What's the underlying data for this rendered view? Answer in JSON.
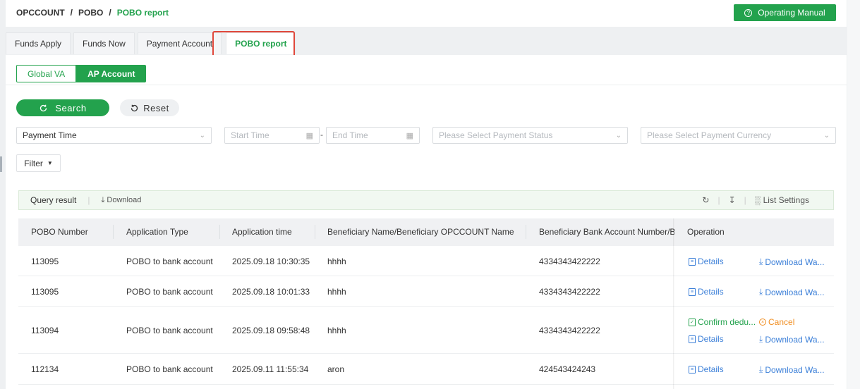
{
  "breadcrumb": {
    "root": "OPCCOUNT",
    "mid": "POBO",
    "current": "POBO report",
    "sep": "/"
  },
  "header": {
    "manual_label": "Operating Manual",
    "manual_icon": "question-circle-icon"
  },
  "tabs": [
    {
      "label": "Funds Apply"
    },
    {
      "label": "Funds Now"
    },
    {
      "label": "Payment Account"
    },
    {
      "label": "POBO report",
      "active": true
    }
  ],
  "segment": {
    "off_label": "Global VA",
    "on_label": "AP Account"
  },
  "actions": {
    "search_label": "Search",
    "reset_label": "Reset"
  },
  "filters": {
    "time_type_value": "Payment Time",
    "start_placeholder": "Start Time",
    "end_placeholder": "End Time",
    "range_sep": "-",
    "status_placeholder": "Please Select Payment Status",
    "currency_placeholder": "Please Select Payment Currency",
    "filter_label": "Filter"
  },
  "query_bar": {
    "result_label": "Query result",
    "download_label": "Download",
    "list_settings_label": "List Settings",
    "sep": "|"
  },
  "table": {
    "columns": [
      "POBO Number",
      "Application Type",
      "Application time",
      "Beneficiary Name/Beneficiary OPCCOUNT Name",
      "Beneficiary Bank Account Number/Ber",
      "Operation"
    ],
    "rows": [
      {
        "number": "113095",
        "type": "POBO to bank account",
        "time": "2025.09.18 10:30:35",
        "name": "hhhh",
        "account": "4334343422222"
      },
      {
        "number": "113095",
        "type": "POBO to bank account",
        "time": "2025.09.18 10:01:33",
        "name": "hhhh",
        "account": "4334343422222"
      },
      {
        "number": "113094",
        "type": "POBO to bank account",
        "time": "2025.09.18 09:58:48",
        "name": "hhhh",
        "account": "4334343422222"
      },
      {
        "number": "112134",
        "type": "POBO to bank account",
        "time": "2025.09.11 11:55:34",
        "name": "aron",
        "account": "424543424243"
      }
    ],
    "ops": {
      "details": "Details",
      "download": "Download Wa...",
      "confirm": "Confirm dedu...",
      "cancel": "Cancel"
    }
  },
  "colors": {
    "accent": "#23a24d",
    "link": "#3b7fd8",
    "warning": "#f08c1e",
    "highlight": "#e0483b"
  }
}
